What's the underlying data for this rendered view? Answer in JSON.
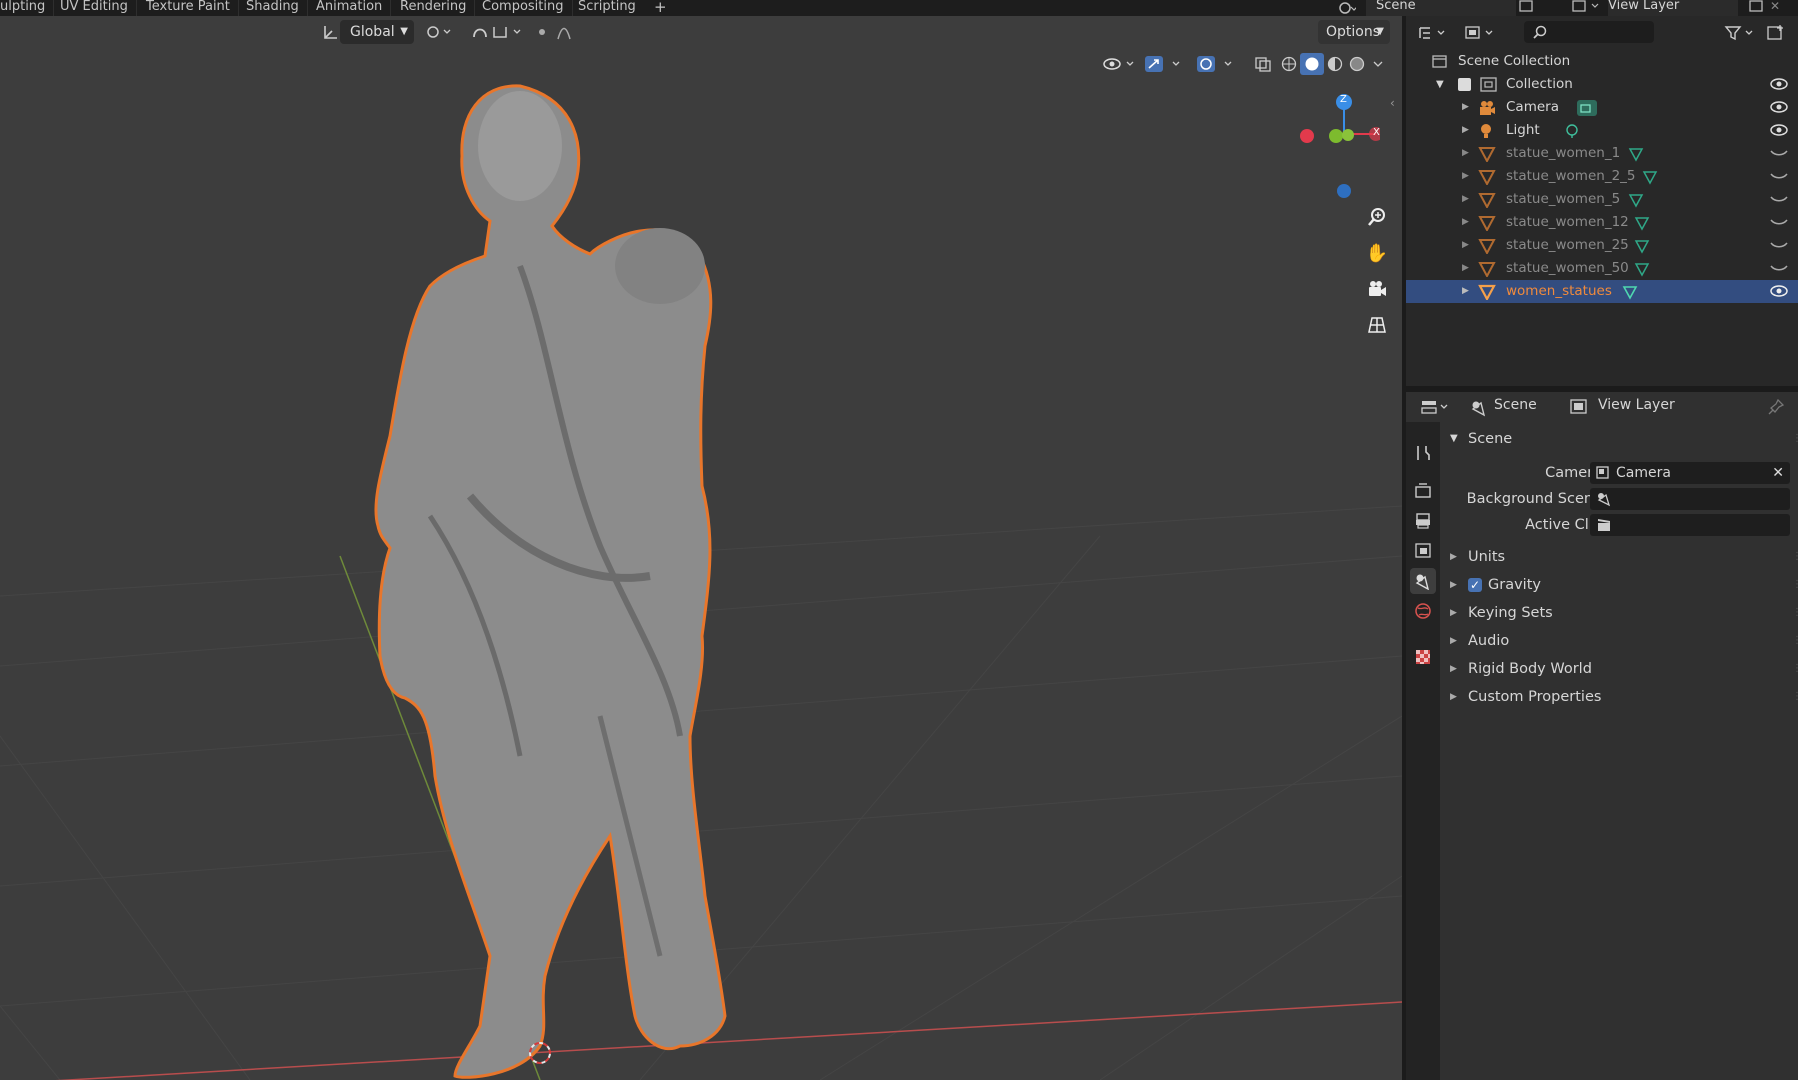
{
  "topbar": {
    "tabs": [
      "ulpting",
      "UV Editing",
      "Texture Paint",
      "Shading",
      "Animation",
      "Rendering",
      "Compositing",
      "Scripting"
    ],
    "add_tab": "+",
    "scene_name": "Scene",
    "view_layer": "View Layer"
  },
  "viewport_header": {
    "transform_orientation": "Global",
    "options_label": "Options"
  },
  "gizmo": {
    "z": "Z",
    "x": "X"
  },
  "outliner": {
    "scene_collection": "Scene Collection",
    "collection": "Collection",
    "items": [
      {
        "label": "Camera",
        "type": "camera",
        "visible": true
      },
      {
        "label": "Light",
        "type": "light",
        "visible": true
      },
      {
        "label": "statue_women_1",
        "type": "mesh",
        "visible": false
      },
      {
        "label": "statue_women_2_5",
        "type": "mesh",
        "visible": false
      },
      {
        "label": "statue_women_5",
        "type": "mesh",
        "visible": false
      },
      {
        "label": "statue_women_12",
        "type": "mesh",
        "visible": false
      },
      {
        "label": "statue_women_25",
        "type": "mesh",
        "visible": false
      },
      {
        "label": "statue_women_50",
        "type": "mesh",
        "visible": false
      },
      {
        "label": "women_statues",
        "type": "mesh",
        "visible": true,
        "selected": true
      }
    ]
  },
  "properties": {
    "header_scene": "Scene",
    "header_view_layer": "View Layer",
    "panel_title": "Scene",
    "camera_label": "Camera",
    "camera_value": "Camera",
    "background_scene_label": "Background Scene",
    "active_clip_label": "Active Clip",
    "sections": [
      "Units",
      "Gravity",
      "Keying Sets",
      "Audio",
      "Rigid Body World",
      "Custom Properties"
    ],
    "gravity_checked": true
  },
  "colors": {
    "selection_outline": "#e8762b",
    "selected_row": "#334d80",
    "x_axis": "#e33a4c",
    "y_axis": "#7dbb2e",
    "z_axis": "#3a8ee6"
  }
}
